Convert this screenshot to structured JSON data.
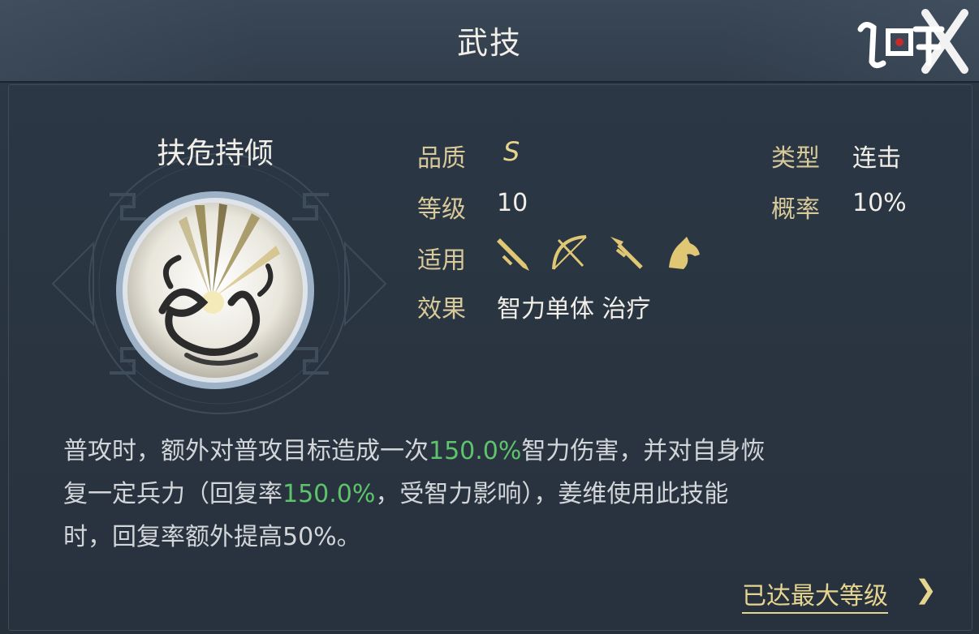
{
  "header": {
    "title": "武技",
    "logo_text": "鸿图之下"
  },
  "skill": {
    "name": "扶危持倾",
    "icon": "skill-emblem-icon",
    "quality_label": "品质",
    "quality_value": "S",
    "level_label": "等级",
    "level_value": "10",
    "usable_label": "适用",
    "usable_icons": [
      "sword-icon",
      "bow-icon",
      "spear-icon",
      "horse-icon"
    ],
    "effect_label": "效果",
    "effect_value": "智力单体 治疗",
    "type_label": "类型",
    "type_value": "连击",
    "chance_label": "概率",
    "chance_value": "10%"
  },
  "description": {
    "p1": "普攻时，额外对普攻目标造成一次",
    "hl1": "150.0%",
    "p2": "智力伤害，并对自身恢",
    "p3": "复一定兵力（回复率",
    "hl2": "150.0%",
    "p4": "，受智力影响），姜维使用此技能",
    "p5": "时，回复率额外提高50%。"
  },
  "footer": {
    "max_level_text": "已达最大等级",
    "arrow": "❯"
  },
  "colors": {
    "gold": "#e6d58f",
    "highlight_green": "#5ec46c",
    "label_gold": "#d8c99a"
  }
}
